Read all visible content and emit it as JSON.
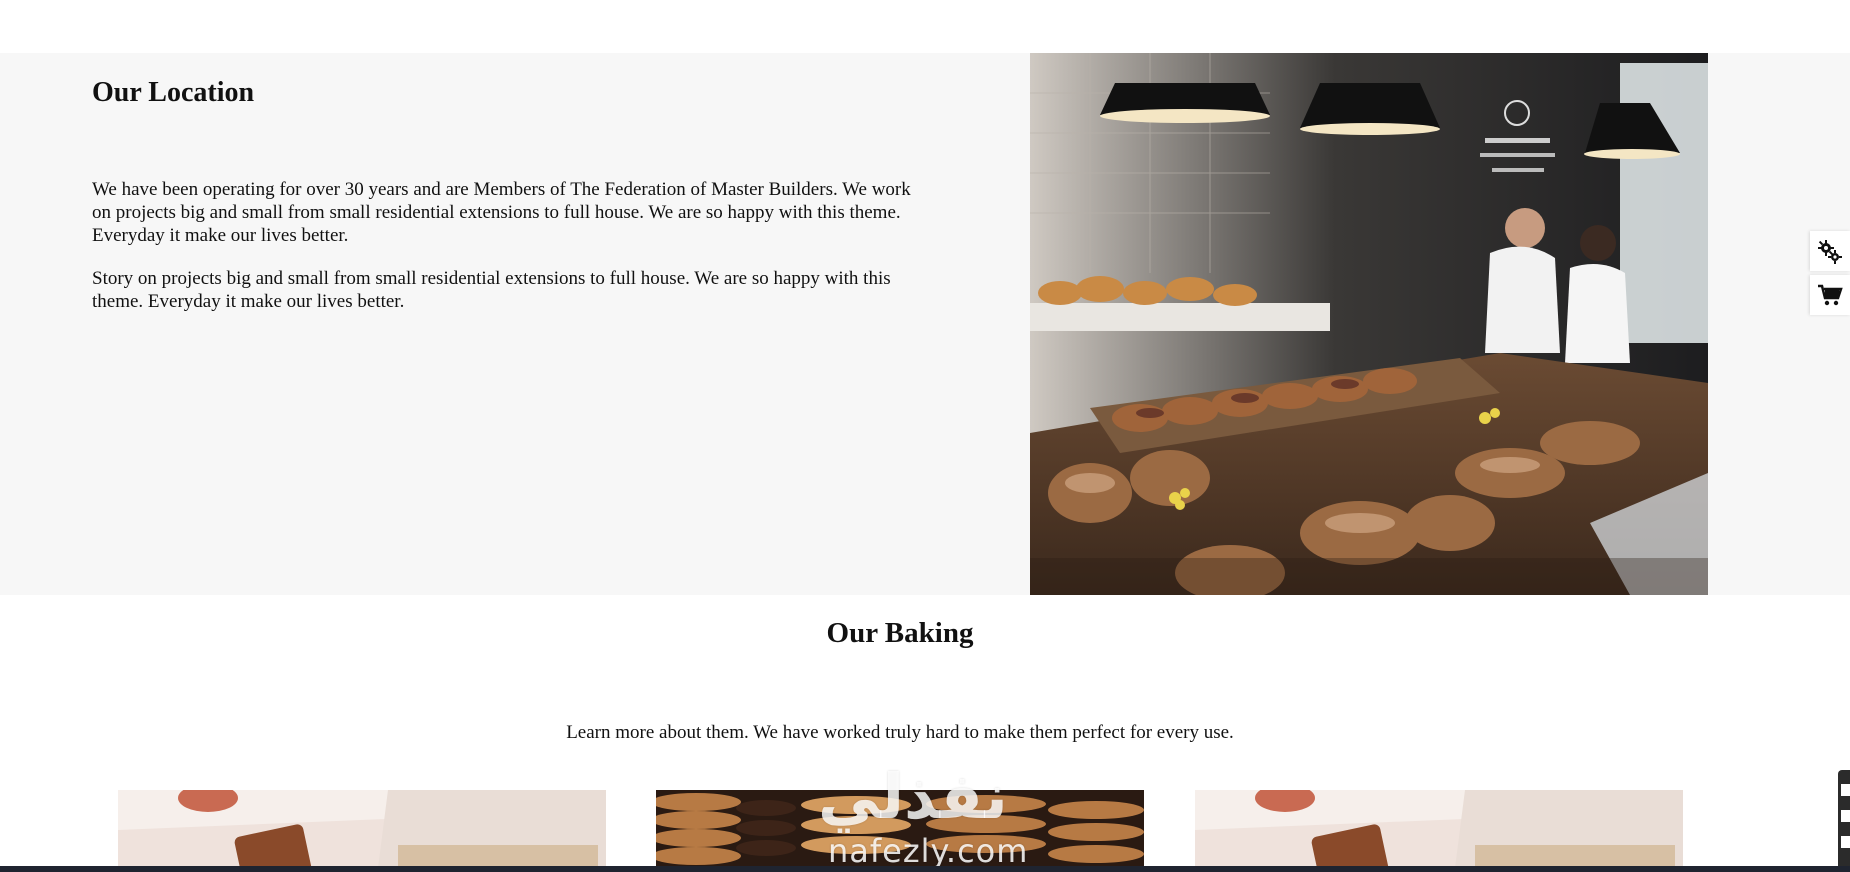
{
  "location": {
    "title": "Our Location",
    "paragraph_1": "We have been operating for over 30 years and are Members of The Federation of Master Builders. We work on projects big and small from small residential extensions to full house. We are so happy with this theme. Everyday it make our lives better.",
    "paragraph_2": "Story on projects big and small from small residential extensions to full house. We are so happy with this theme. Everyday it make our lives better."
  },
  "baking": {
    "title": "Our Baking",
    "subtitle": "Learn more about them. We have worked truly hard to make them perfect for every use."
  },
  "watermark": {
    "arabic": "نفذلي",
    "latin": "nafezly.com"
  },
  "icons": {
    "settings": "gears-icon",
    "cart": "cart-icon"
  }
}
